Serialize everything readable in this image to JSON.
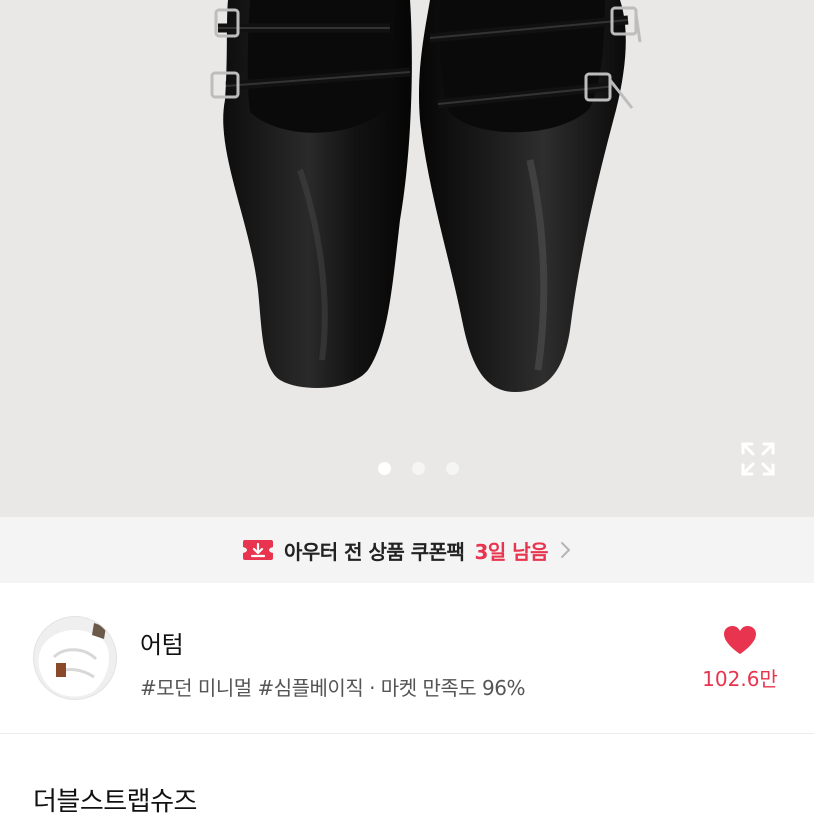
{
  "gallery": {
    "image_alt": "black leather double strap flat shoes",
    "slide_count": 3,
    "active_slide": 1
  },
  "coupon": {
    "text": "아우터 전 상품 쿠폰팩",
    "highlight": "3일 남음"
  },
  "store": {
    "name": "어텀",
    "tags": "#모던 미니멀 #심플베이직 · 마켓 만족도 96%",
    "like_count": "102.6만"
  },
  "product": {
    "title": "더블스트랩슈즈"
  },
  "colors": {
    "accent": "#e8344e",
    "image_background": "#e9e8e6",
    "banner_background": "#f4f4f4"
  }
}
